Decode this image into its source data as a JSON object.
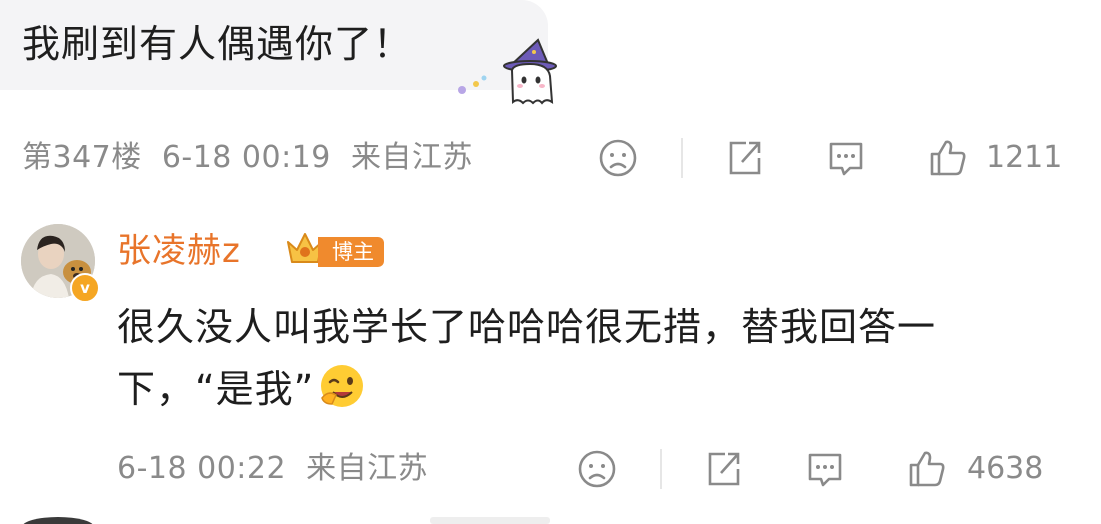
{
  "comment": {
    "text": "我刷到有人偶遇你了！",
    "floor": "第347楼",
    "time": "6-18 00:19",
    "location": "来自江苏",
    "likes": "1211"
  },
  "reply": {
    "username": "张凌赫z",
    "author_badge": "博主",
    "verified_mark": "v",
    "text": "很久没人叫我学长了哈哈哈很无措，替我回答一下，“是我”",
    "time": "6-18 00:22",
    "location": "来自江苏",
    "likes": "4638"
  },
  "icons": {
    "dislike": "sad-face-icon",
    "share": "share-icon",
    "comment": "comment-icon",
    "like": "thumbs-up-icon"
  },
  "colors": {
    "username": "#e8742a",
    "badge": "#f08a2d",
    "meta": "#8a8a8a"
  }
}
